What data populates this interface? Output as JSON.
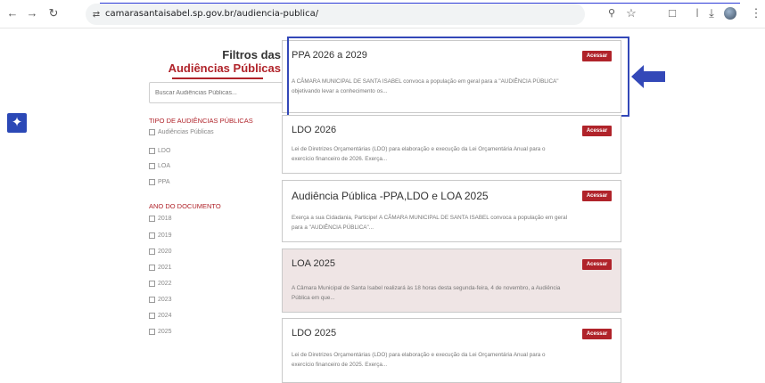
{
  "browser": {
    "url": "camarasantaisabel.sp.gov.br/audiencia-publica/"
  },
  "sidebar": {
    "title_line1": "Filtros das",
    "title_line2": "Audiências Públicas",
    "search_placeholder": "Buscar Audiências Públicas...",
    "group1_title": "TIPO DE AUDIÊNCIAS PÚBLICAS",
    "group1_options": [
      "Audiências Públicas",
      "LDO",
      "LOA",
      "PPA"
    ],
    "group2_title": "ANO DO DOCUMENTO",
    "group2_options": [
      "2018",
      "2019",
      "2020",
      "2021",
      "2022",
      "2023",
      "2024",
      "2025"
    ]
  },
  "cards": [
    {
      "title": "PPA 2026 a 2029",
      "button": "Acessar",
      "desc1": "A CÂMARA MUNICIPAL DE SANTA ISABEL convoca a população em geral para a \"AUDIÊNCIA PÚBLICA\"",
      "desc2": "objetivando levar a conhecimento os..."
    },
    {
      "title": "LDO 2026",
      "button": "Acessar",
      "desc1": "Lei de Diretrizes Orçamentárias (LDO) para elaboração e execução da Lei Orçamentária Anual para o",
      "desc2": "exercício financeiro de 2026. Exerça..."
    },
    {
      "title": "Audiência Pública -PPA,LDO e LOA 2025",
      "button": "Acessar",
      "desc1": "Exerça a sua Cidadania, Participe! A CÂMARA MUNICIPAL DE SANTA ISABEL convoca a população em geral",
      "desc2": "para a \"AUDIÊNCIA PÚBLICA\"..."
    },
    {
      "title": "LOA 2025",
      "button": "Acessar",
      "desc1": "A Câmara Municipal de Santa Isabel realizará às 18 horas desta segunda-feira, 4 de novembro, a Audiência",
      "desc2": "Pública em que..."
    },
    {
      "title": "LDO 2025",
      "button": "Acessar",
      "desc1": "Lei de Diretrizes Orçamentárias (LDO) para elaboração e execução da Lei Orçamentária Anual para o",
      "desc2": "exercício financeiro de 2025. Exerça..."
    }
  ],
  "colors": {
    "accent": "#b0232a",
    "highlight": "#3348b8"
  }
}
